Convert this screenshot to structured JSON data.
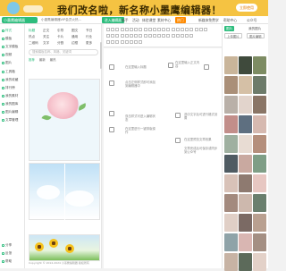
{
  "banner": {
    "title": "我们改名啦，新名称小墨鹰编辑器！",
    "button": "立即使用"
  },
  "topbar": {
    "logo": "小墨鹰编辑器",
    "notice": "小墨鹰编辑器VIP会员火热...",
    "tabs": [
      "进入编辑器",
      "新手",
      "活动",
      "体验课堂",
      "素材中心",
      "新媒体免费学",
      "帮助中心",
      "公众号"
    ],
    "hot_tab": "热门"
  },
  "sidebar": {
    "items": [
      "样式",
      "模板",
      "文字模板",
      "视频",
      "图片",
      "工具箱",
      "我的收藏",
      "排行榜",
      "我的素材",
      "我的图库",
      "图片编辑",
      "文章管理"
    ],
    "bottom": [
      "分享",
      "反馈",
      "帮助"
    ]
  },
  "panel": {
    "categories": [
      "标题",
      "正文",
      "引导",
      "图文",
      "节日",
      "热点",
      "关注",
      "卡片",
      "通用",
      "行业",
      "二维码",
      "文字",
      "分割",
      "边框",
      "更多"
    ],
    "active_category": "标题",
    "search_placeholder": "搜索模板名称、风格、关键词",
    "subtabs": [
      "推荐",
      "最新",
      "最热"
    ],
    "copyright": "Copyright © 2014-2024 小墨鹰编辑器 版权所有"
  },
  "editor_toolbar": {
    "row1": [
      "撤销",
      "重做",
      "格式刷",
      "清除格式",
      "字号",
      "字体",
      "加粗",
      "斜体",
      "下划线",
      "颜色"
    ],
    "row2": [
      "对齐",
      "行距",
      "缩进",
      "列表",
      "链接",
      "表格",
      "图片",
      "视频",
      "更多"
    ]
  },
  "editor": {
    "notes": [
      "在这里输入标题",
      "在这里输入正文内容",
      "点击左侧样式即可添加到编辑器中",
      "双击样式可进入编辑状态",
      "选中文字后可进行格式设置",
      "在这里进行一键排版操作",
      "在这里预览文章效果",
      "文章完成后可保存或同步到公众号"
    ]
  },
  "right_panel": {
    "tabs": [
      "图片",
      "我的图片"
    ],
    "buttons": [
      "上传图片",
      "图片编辑"
    ]
  },
  "colors": {
    "accent": "#2dbd7d",
    "banner": "#f5c342",
    "hot": "#ff8a00"
  }
}
